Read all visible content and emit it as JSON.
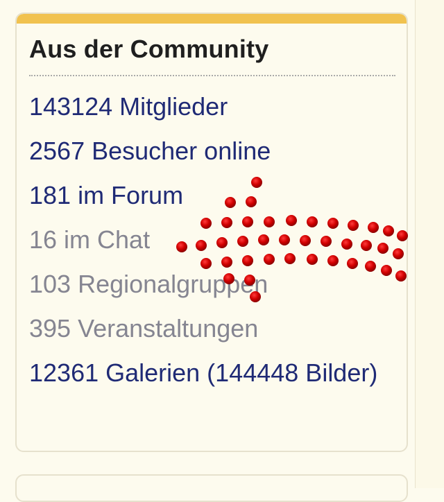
{
  "community": {
    "title": "Aus der Community",
    "stats": [
      {
        "text": "143124 Mitglieder",
        "muted": false
      },
      {
        "text": "2567 Besucher online",
        "muted": false
      },
      {
        "text": "181 im Forum",
        "muted": false
      },
      {
        "text": "16 im Chat",
        "muted": true
      },
      {
        "text": "103 Regionalgruppen",
        "muted": true
      },
      {
        "text": "395 Veranstaltungen",
        "muted": true
      },
      {
        "text": "12361 Galerien (144448 Bilder)",
        "muted": false
      }
    ]
  },
  "colors": {
    "accent_bar": "#f1c24f",
    "link": "#1f2a75",
    "muted_link": "#858591",
    "arrow": "#cc0000"
  },
  "icons": {
    "pointer": "dotted-arrow-icon"
  }
}
